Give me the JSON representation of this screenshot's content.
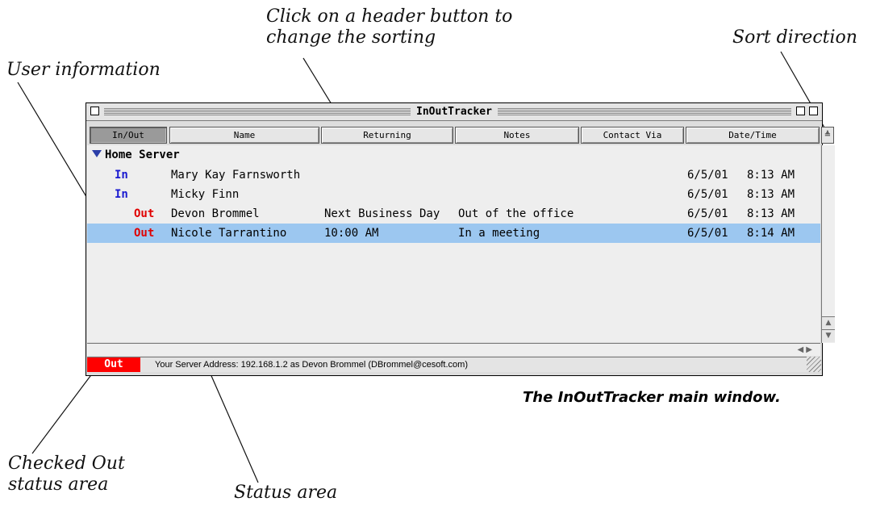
{
  "annotations": {
    "header_hint_line1": "Click on a header button to",
    "header_hint_line2": "change the sorting",
    "sort_direction": "Sort direction",
    "user_information": "User information",
    "checked_out_line1": "Checked Out",
    "checked_out_line2": "status area",
    "status_area": "Status area"
  },
  "caption": "The InOutTracker main window.",
  "window": {
    "title": "InOutTracker",
    "columns": [
      "In/Out",
      "Name",
      "Returning",
      "Notes",
      "Contact Via",
      "Date/Time"
    ],
    "sorted_column": "In/Out",
    "group": "Home Server",
    "rows": [
      {
        "status": "In",
        "name": "Mary Kay Farnsworth",
        "returning": "",
        "notes": "",
        "date": "6/5/01",
        "time": "8:13 AM",
        "selected": false
      },
      {
        "status": "In",
        "name": "Micky Finn",
        "returning": "",
        "notes": "",
        "date": "6/5/01",
        "time": "8:13 AM",
        "selected": false
      },
      {
        "status": "Out",
        "name": "Devon Brommel",
        "returning": "Next Business Day",
        "notes": "Out of the office",
        "date": "6/5/01",
        "time": "8:13 AM",
        "selected": false
      },
      {
        "status": "Out",
        "name": "Nicole Tarrantino",
        "returning": "10:00 AM",
        "notes": "In a meeting",
        "date": "6/5/01",
        "time": "8:14 AM",
        "selected": true
      }
    ],
    "status_bar": {
      "my_status": "Out",
      "message": "Your Server Address: 192.168.1.2 as Devon Brommel (DBrommel@cesoft.com)"
    },
    "colors": {
      "in": "#1a1ad0",
      "out": "#e00000",
      "selection": "#9cc7f0",
      "out_area": "#ff0000"
    }
  }
}
